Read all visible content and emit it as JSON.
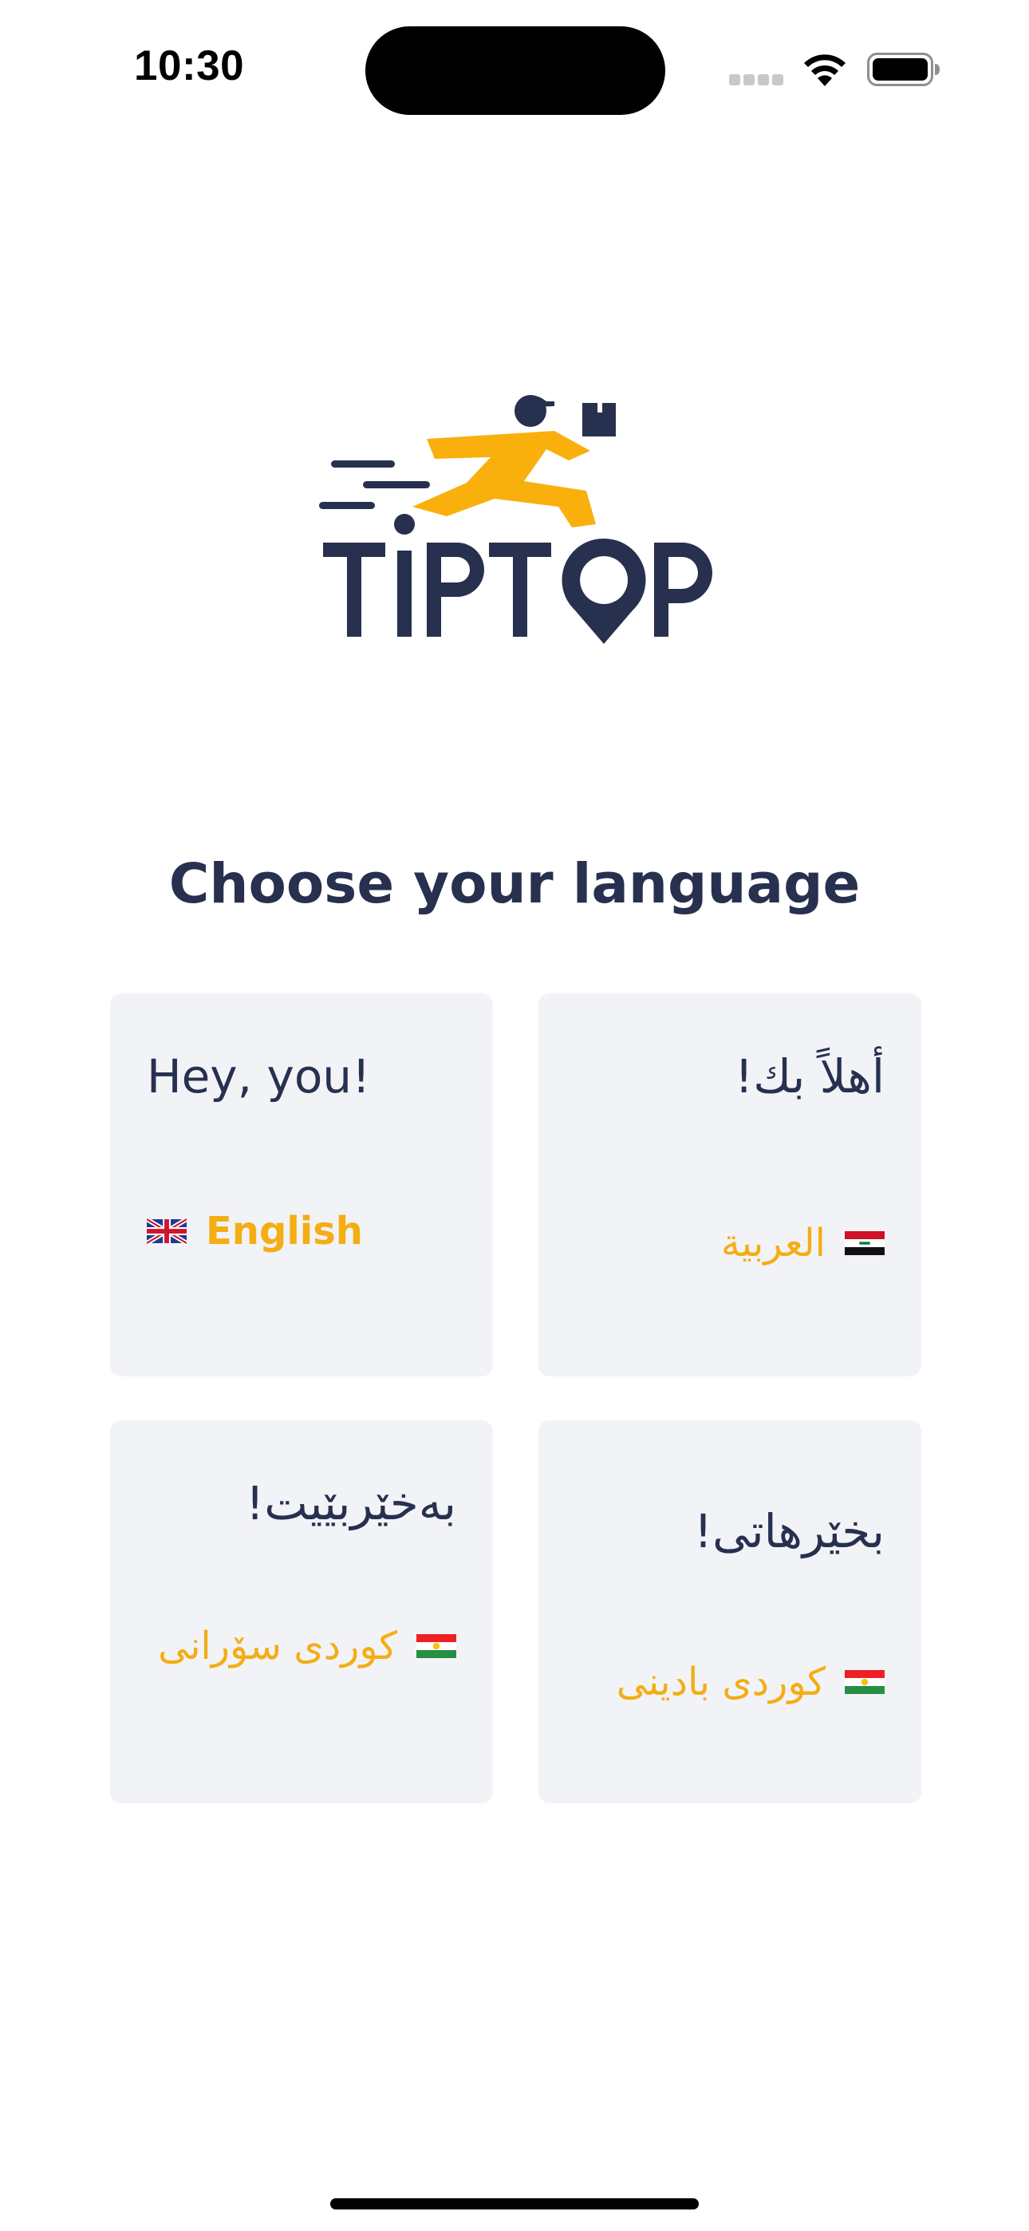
{
  "status_bar": {
    "time": "10:30"
  },
  "logo": {
    "text": "TIPTOP",
    "icon": "running-courier-logo",
    "colors": {
      "navy": "#27304f",
      "yellow": "#f9b00d"
    }
  },
  "heading": "Choose your language",
  "languages": [
    {
      "greeting": "Hey, you!",
      "label": "English",
      "flag": "uk-flag-icon",
      "dir": "ltr"
    },
    {
      "greeting": "أهلاً بك!",
      "label": "العربية",
      "flag": "iraq-flag-icon",
      "dir": "rtl"
    },
    {
      "greeting": "بەخێربێیت!",
      "label": "کوردی سۆرانی",
      "flag": "kurdistan-flag-icon",
      "dir": "rtl"
    },
    {
      "greeting": "بخێرهاتی!",
      "label": "کوردی بادینی",
      "flag": "kurdistan-flag-icon",
      "dir": "rtl"
    }
  ],
  "colors": {
    "text": "#27304f",
    "accent": "#f4ad13",
    "card_background": "#f2f3f7"
  }
}
